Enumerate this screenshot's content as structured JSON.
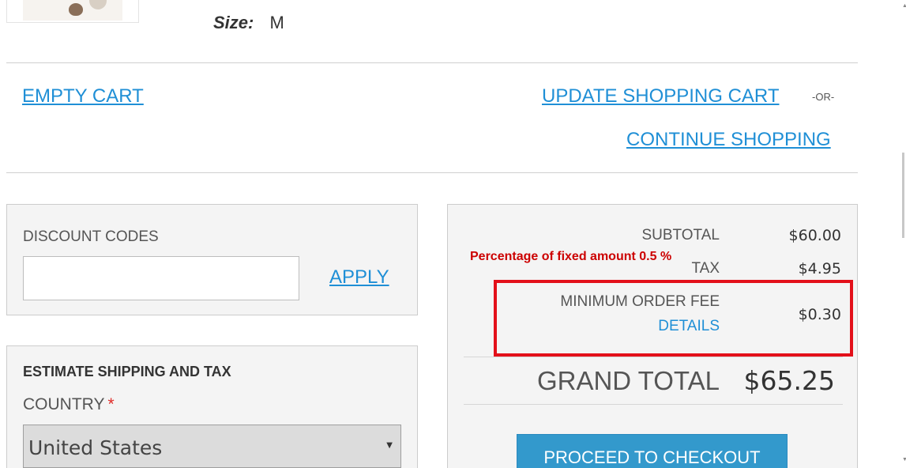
{
  "product": {
    "size_label": "Size:",
    "size_value": "M"
  },
  "cart_actions": {
    "empty_cart": "EMPTY CART",
    "update_cart": "UPDATE SHOPPING CART",
    "or_text": "-OR-",
    "continue_shopping": "CONTINUE SHOPPING"
  },
  "discount": {
    "title": "DISCOUNT CODES",
    "input_value": "",
    "apply_label": "APPLY"
  },
  "shipping": {
    "title": "ESTIMATE SHIPPING AND TAX",
    "country_label": "COUNTRY",
    "required_mark": "*",
    "country_selected": "United States"
  },
  "summary": {
    "subtotal_label": "SUBTOTAL",
    "subtotal_value": "$60.00",
    "tax_label": "TAX",
    "tax_value": "$4.95",
    "fee_label": "MINIMUM ORDER FEE",
    "fee_details": "DETAILS",
    "fee_value": "$0.30",
    "grand_total_label": "GRAND TOTAL",
    "grand_total_value": "$65.25",
    "checkout_label": "PROCEED TO CHECKOUT"
  },
  "annotation": {
    "text": "Percentage of fixed amount 0.5 %",
    "color": "#e3101a"
  },
  "colors": {
    "link": "#1f8fd6",
    "button": "#3399cc",
    "required": "#e02b27"
  }
}
